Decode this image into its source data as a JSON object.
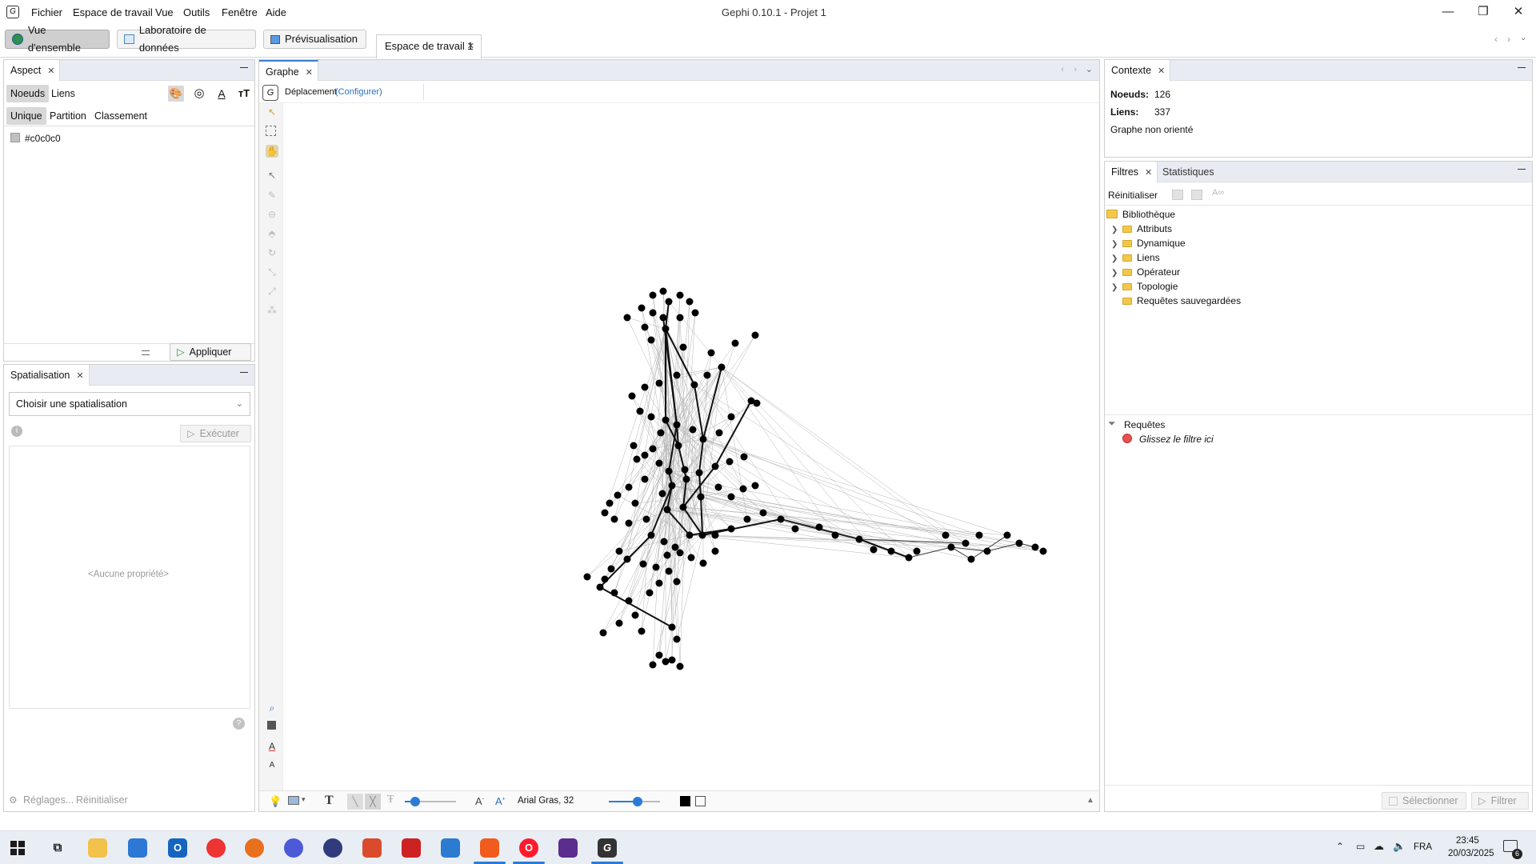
{
  "menu": {
    "items": [
      "Fichier",
      "Espace de travail",
      "Vue",
      "Outils",
      "Fenêtre",
      "Aide"
    ]
  },
  "window": {
    "title": "Gephi 0.10.1 - Projet 1"
  },
  "workspace_bar": {
    "overview": "Vue d'ensemble",
    "data_lab": "Laboratoire de données",
    "preview": "Prévisualisation",
    "workspace_tab": "Espace de travail 1"
  },
  "aspect": {
    "tab": "Aspect",
    "sub_nodes": "Noeuds",
    "sub_links": "Liens",
    "mode_unique": "Unique",
    "mode_partition": "Partition",
    "mode_ranking": "Classement",
    "color_value": "#c0c0c0",
    "apply": "Appliquer"
  },
  "layout_panel": {
    "tab": "Spatialisation",
    "select_placeholder": "Choisir une spatialisation",
    "run": "Exécuter",
    "no_property": "<Aucune propriété>",
    "settings": "Réglages...",
    "reset": "Réinitialiser"
  },
  "graph": {
    "tab": "Graphe",
    "mode_label": "Déplacement",
    "configure": "(Configurer)",
    "font_label": "Arial Gras, 32"
  },
  "context": {
    "tab": "Contexte",
    "nodes_label": "Noeuds:",
    "nodes_value": "126",
    "links_label": "Liens:",
    "links_value": "337",
    "graph_type": "Graphe non orienté"
  },
  "filters": {
    "tab": "Filtres",
    "tab_stats": "Statistiques",
    "reset": "Réinitialiser",
    "library": "Bibliothèque",
    "folders": [
      "Attributs",
      "Dynamique",
      "Liens",
      "Opérateur",
      "Topologie",
      "Requêtes sauvegardées"
    ],
    "queries": "Requêtes",
    "drop_hint": "Glissez le filtre ici",
    "select": "Sélectionner",
    "filter": "Filtrer"
  },
  "taskbar": {
    "lang": "FRA",
    "time": "23:45",
    "date": "20/03/2025",
    "notif": "6"
  },
  "colors": {
    "accent": "#2a7bd6",
    "node": "#000000",
    "panel_header": "#e8ecf2"
  }
}
